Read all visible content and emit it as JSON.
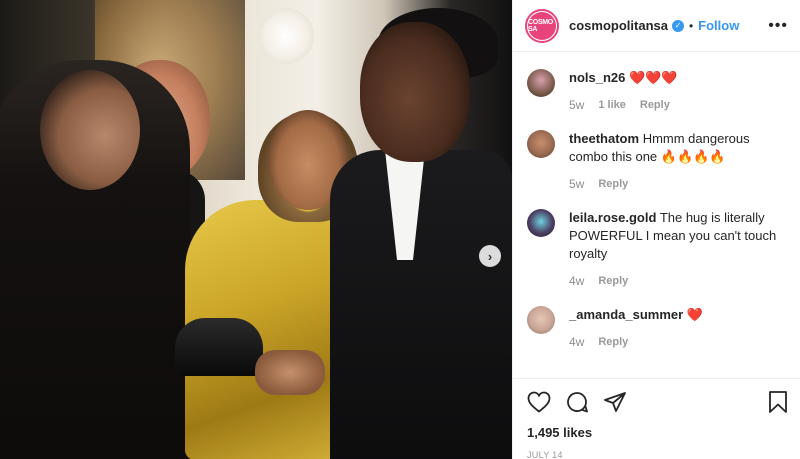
{
  "post": {
    "username": "cosmopolitansa",
    "avatar_text": "COSMO SA",
    "follow_label": "Follow",
    "separator": "•",
    "more_label": "•••",
    "next_label": "›",
    "likes": "1,495 likes",
    "date": "JULY 14"
  },
  "comments": [
    {
      "user": "nols_n26",
      "text": "",
      "emoji": "❤️❤️❤️",
      "emoji_type": "heart",
      "age": "5w",
      "likes": "1 like",
      "reply": "Reply",
      "avatar_color": "#7a5a4a"
    },
    {
      "user": "theethatom",
      "text": "Hmmm dangerous combo this one",
      "emoji": "🔥🔥🔥🔥",
      "emoji_type": "fire",
      "age": "5w",
      "likes": "",
      "reply": "Reply",
      "avatar_color": "#9a6b52"
    },
    {
      "user": "leila.rose.gold",
      "text": "The hug is literally POWERFUL I mean you can't touch royalty",
      "emoji": "",
      "emoji_type": "",
      "age": "4w",
      "likes": "",
      "reply": "Reply",
      "avatar_color": "#4b3f63"
    },
    {
      "user": "_amanda_summer",
      "text": "",
      "emoji": "❤️",
      "emoji_type": "heart",
      "age": "4w",
      "likes": "",
      "reply": "Reply",
      "avatar_color": "#c8a596"
    }
  ],
  "icons": {
    "like": "heart-outline-icon",
    "comment": "comment-bubble-icon",
    "share": "share-icon",
    "save": "bookmark-icon",
    "verified": "verified-badge-icon"
  },
  "colors": {
    "accent": "#3897f0",
    "brand": "#e8437a",
    "text": "#262626",
    "muted": "#999999"
  }
}
